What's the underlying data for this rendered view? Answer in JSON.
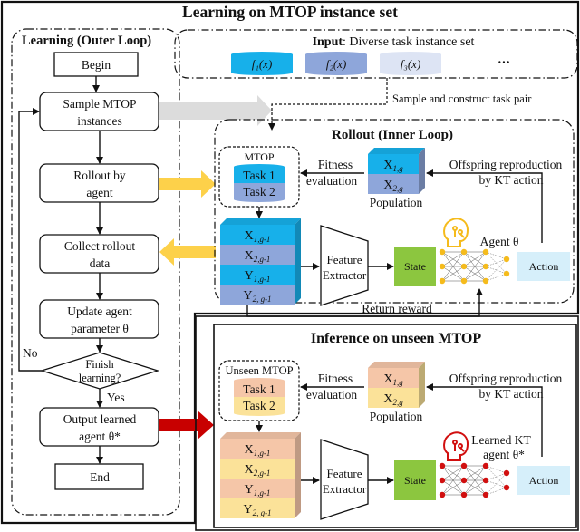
{
  "title": "Learning on MTOP instance set",
  "outer_loop": {
    "title": "Learning (Outer Loop)",
    "steps": {
      "begin": "Begin",
      "sample_1": "Sample MTOP",
      "sample_2": "instances",
      "rollout_1": "Rollout by",
      "rollout_2": "agent",
      "collect_1": "Collect rollout",
      "collect_2": "data",
      "update_1": "Update agent",
      "update_2": "parameter θ",
      "decision_1": "Finish",
      "decision_2": "learning?",
      "no": "No",
      "yes": "Yes",
      "output_1": "Output learned",
      "output_2": "agent θ*",
      "end": "End"
    }
  },
  "input": {
    "label_bold": "Input",
    "label_rest": ": Diverse task instance set",
    "instances": [
      "f₁(x)",
      "f₂(x)",
      "f₃(x)"
    ],
    "ellipsis": "···",
    "colors": [
      "#17b0ea",
      "#8ea6da",
      "#dde4f4"
    ],
    "sample_note": "Sample and construct task pair"
  },
  "rollout": {
    "title": "Rollout (Inner Loop)",
    "mtop_label": "MTOP",
    "task1": "Task 1",
    "task2": "Task 2",
    "fitness_1": "Fitness",
    "fitness_2": "evaluation",
    "pop_x1": "X1,g",
    "pop_x2": "X2,g",
    "population": "Population",
    "offspring_1": "Offspring reproduction",
    "offspring_2": "by KT action",
    "stack": [
      "X1,g-1",
      "X2,g-1",
      "Y1,g-1",
      "Y2, g-1"
    ],
    "feature_1": "Feature",
    "feature_2": "Extractor",
    "state": "State",
    "agent": "Agent θ",
    "action": "Action",
    "reward": "Return reward",
    "colors": {
      "primary": "#17b0ea",
      "secondary": "#8ea6da",
      "node": "#f5bb1c",
      "state": "#8cc63f",
      "action": "#d6effa"
    }
  },
  "inference": {
    "title": "Inference on unseen MTOP",
    "mtop_label": "Unseen MTOP",
    "task1": "Task 1",
    "task2": "Task 2",
    "fitness_1": "Fitness",
    "fitness_2": "evaluation",
    "pop_x1": "X1,g",
    "pop_x2": "X2,g",
    "population": "Population",
    "offspring_1": "Offspring reproduction",
    "offspring_2": "by KT action",
    "stack": [
      "X1,g-1",
      "X2,g-1",
      "Y1,g-1",
      "Y2, g-1"
    ],
    "feature_1": "Feature",
    "feature_2": "Extractor",
    "state": "State",
    "agent_1": "Learned KT",
    "agent_2": "agent θ*",
    "action": "Action",
    "colors": {
      "primary": "#f5c6a8",
      "secondary": "#fbe299",
      "node": "#d10f0f",
      "state": "#8cc63f",
      "action": "#d6effa"
    }
  },
  "arrow_colors": {
    "gray": "#dcdcdc",
    "yellow": "#fdd14a",
    "red": "#c80000"
  }
}
